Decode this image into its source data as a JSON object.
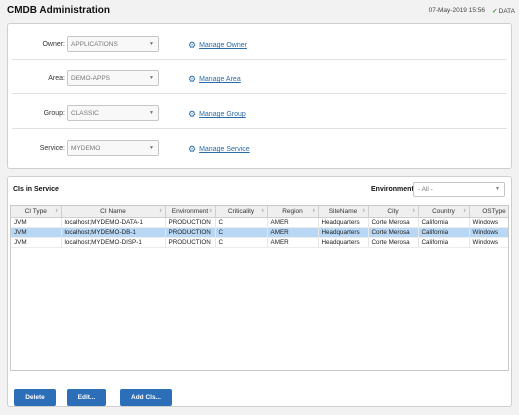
{
  "header": {
    "title": "CMDB Administration",
    "datetime": "07-May-2019 15:56",
    "data_status": "DATA"
  },
  "filters": [
    {
      "label": "Owner:",
      "value": "APPLICATIONS",
      "manage": "Manage Owner"
    },
    {
      "label": "Area:",
      "value": "DEMO-APPS",
      "manage": "Manage Area"
    },
    {
      "label": "Group:",
      "value": "CLASSIC",
      "manage": "Manage Group"
    },
    {
      "label": "Service:",
      "value": "MYDEMO",
      "manage": "Manage Service"
    }
  ],
  "grid": {
    "title": "CIs in Service",
    "environment_label": "Environment:",
    "environment_value": "- All -",
    "columns": [
      "CI Type",
      "CI Name",
      "Environment",
      "Criticality",
      "Region",
      "SiteName",
      "City",
      "Country",
      "OSType"
    ],
    "rows": [
      [
        "JVM",
        "localhost;MYDEMO-DATA-1",
        "PRODUCTION",
        "C",
        "AMER",
        "Headquarters",
        "Corte Merosa",
        "California",
        "Windows"
      ],
      [
        "JVM",
        "localhost;MYDEMO-DB-1",
        "PRODUCTION",
        "C",
        "AMER",
        "Headquarters",
        "Corte Merosa",
        "California",
        "Windows"
      ],
      [
        "JVM",
        "localhost;MYDEMO-DISP-1",
        "PRODUCTION",
        "C",
        "AMER",
        "Headquarters",
        "Corte Merosa",
        "California",
        "Windows"
      ]
    ],
    "selected_row": 1
  },
  "buttons": {
    "delete": "Delete",
    "edit": "Edit...",
    "add": "Add CIs..."
  },
  "icons": {
    "status": "check-icon",
    "manage": "gear-icon",
    "dropdown": "chevron-down-icon",
    "sort": "sort-icon"
  },
  "colors": {
    "link": "#2a6ca8",
    "button": "#2c6fb8",
    "selected_row": "#b7d7f5",
    "status_ok": "#3aa13a"
  }
}
